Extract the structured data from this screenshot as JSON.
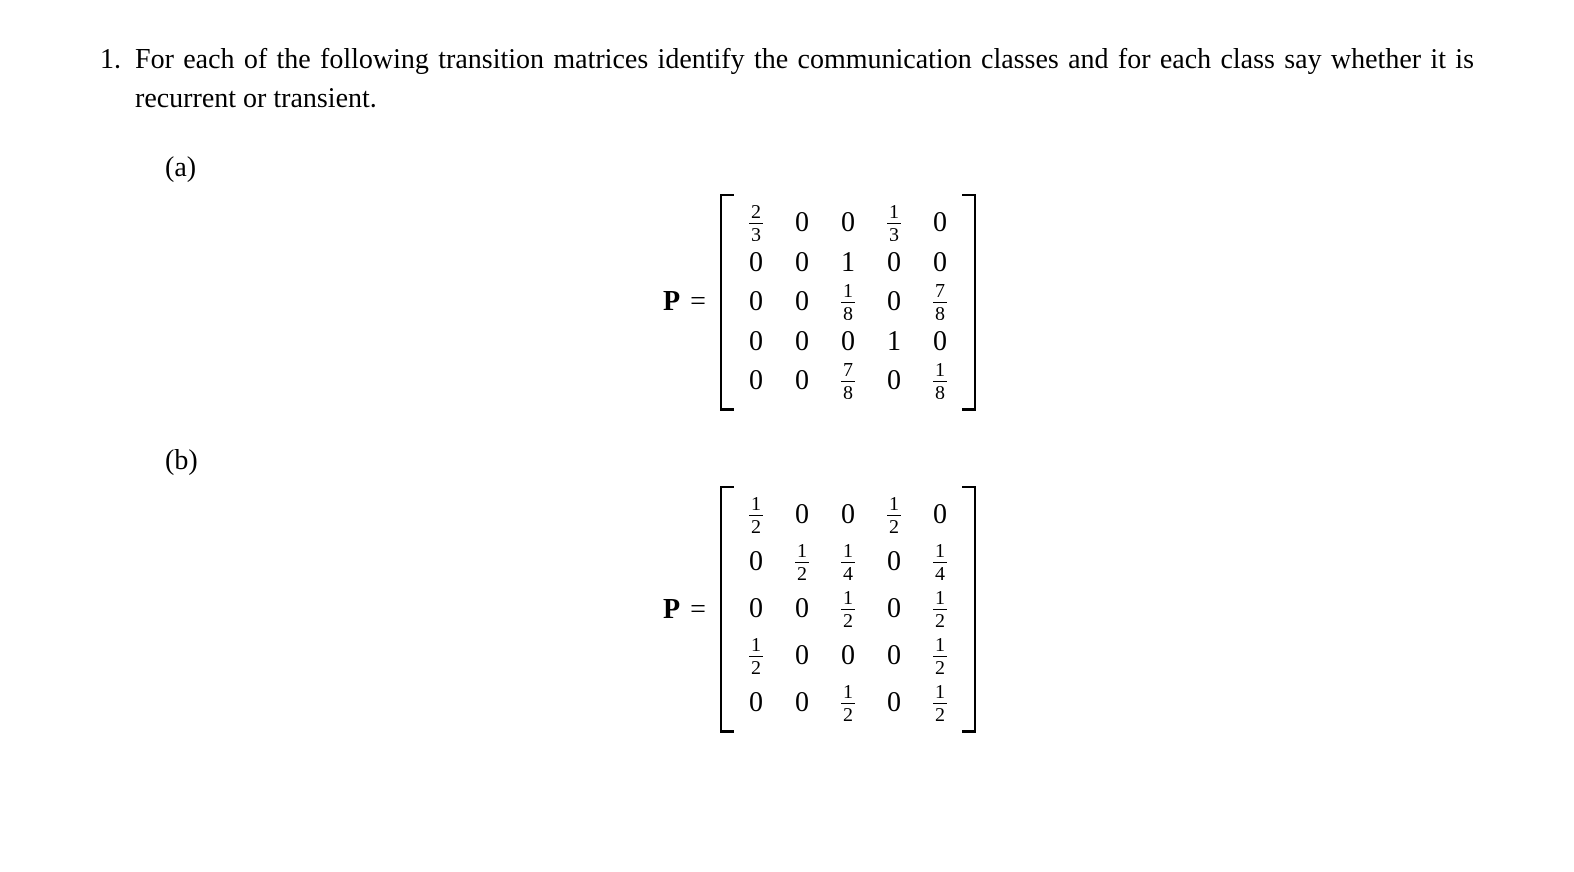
{
  "problem": {
    "number": "1.",
    "text": "For each of the following transition matrices identify the communication classes and for each class say whether it is recurrent or transient."
  },
  "parts": [
    {
      "label": "(a)",
      "lhs": "P",
      "eq": "=",
      "rows": 5,
      "cols": 5,
      "cells": [
        [
          "2/3",
          "0",
          "0",
          "1/3",
          "0"
        ],
        [
          "0",
          "0",
          "1",
          "0",
          "0"
        ],
        [
          "0",
          "0",
          "1/8",
          "0",
          "7/8"
        ],
        [
          "0",
          "0",
          "0",
          "1",
          "0"
        ],
        [
          "0",
          "0",
          "7/8",
          "0",
          "1/8"
        ]
      ]
    },
    {
      "label": "(b)",
      "lhs": "P",
      "eq": "=",
      "rows": 5,
      "cols": 5,
      "cells": [
        [
          "1/2",
          "0",
          "0",
          "1/2",
          "0"
        ],
        [
          "0",
          "1/2",
          "1/4",
          "0",
          "1/4"
        ],
        [
          "0",
          "0",
          "1/2",
          "0",
          "1/2"
        ],
        [
          "1/2",
          "0",
          "0",
          "0",
          "1/2"
        ],
        [
          "0",
          "0",
          "1/2",
          "0",
          "1/2"
        ]
      ]
    }
  ]
}
